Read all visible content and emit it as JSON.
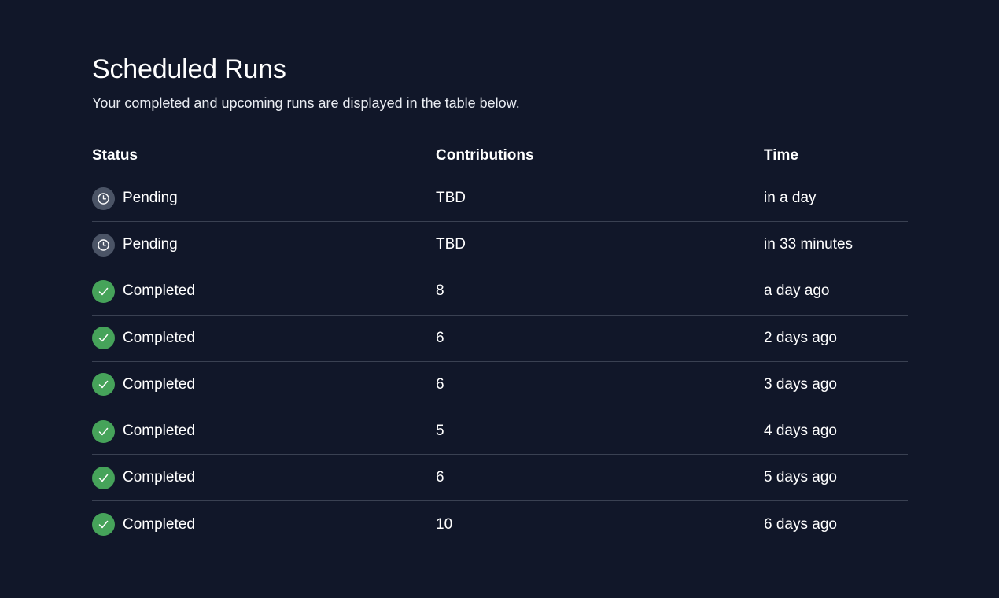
{
  "page": {
    "title": "Scheduled Runs",
    "subtitle": "Your completed and upcoming runs are displayed in the table below."
  },
  "table": {
    "headers": {
      "status": "Status",
      "contributions": "Contributions",
      "time": "Time"
    },
    "rows": [
      {
        "status": "Pending",
        "icon": "clock-icon",
        "contributions": "TBD",
        "time": "in a day"
      },
      {
        "status": "Pending",
        "icon": "clock-icon",
        "contributions": "TBD",
        "time": "in 33 minutes"
      },
      {
        "status": "Completed",
        "icon": "check-icon",
        "contributions": "8",
        "time": "a day ago"
      },
      {
        "status": "Completed",
        "icon": "check-icon",
        "contributions": "6",
        "time": "2 days ago"
      },
      {
        "status": "Completed",
        "icon": "check-icon",
        "contributions": "6",
        "time": "3 days ago"
      },
      {
        "status": "Completed",
        "icon": "check-icon",
        "contributions": "5",
        "time": "4 days ago"
      },
      {
        "status": "Completed",
        "icon": "check-icon",
        "contributions": "6",
        "time": "5 days ago"
      },
      {
        "status": "Completed",
        "icon": "check-icon",
        "contributions": "10",
        "time": "6 days ago"
      }
    ]
  },
  "colors": {
    "background": "#111729",
    "pending_icon_bg": "#4b5466",
    "completed_icon_bg": "#46a35a",
    "row_divider": "#3a4152"
  }
}
